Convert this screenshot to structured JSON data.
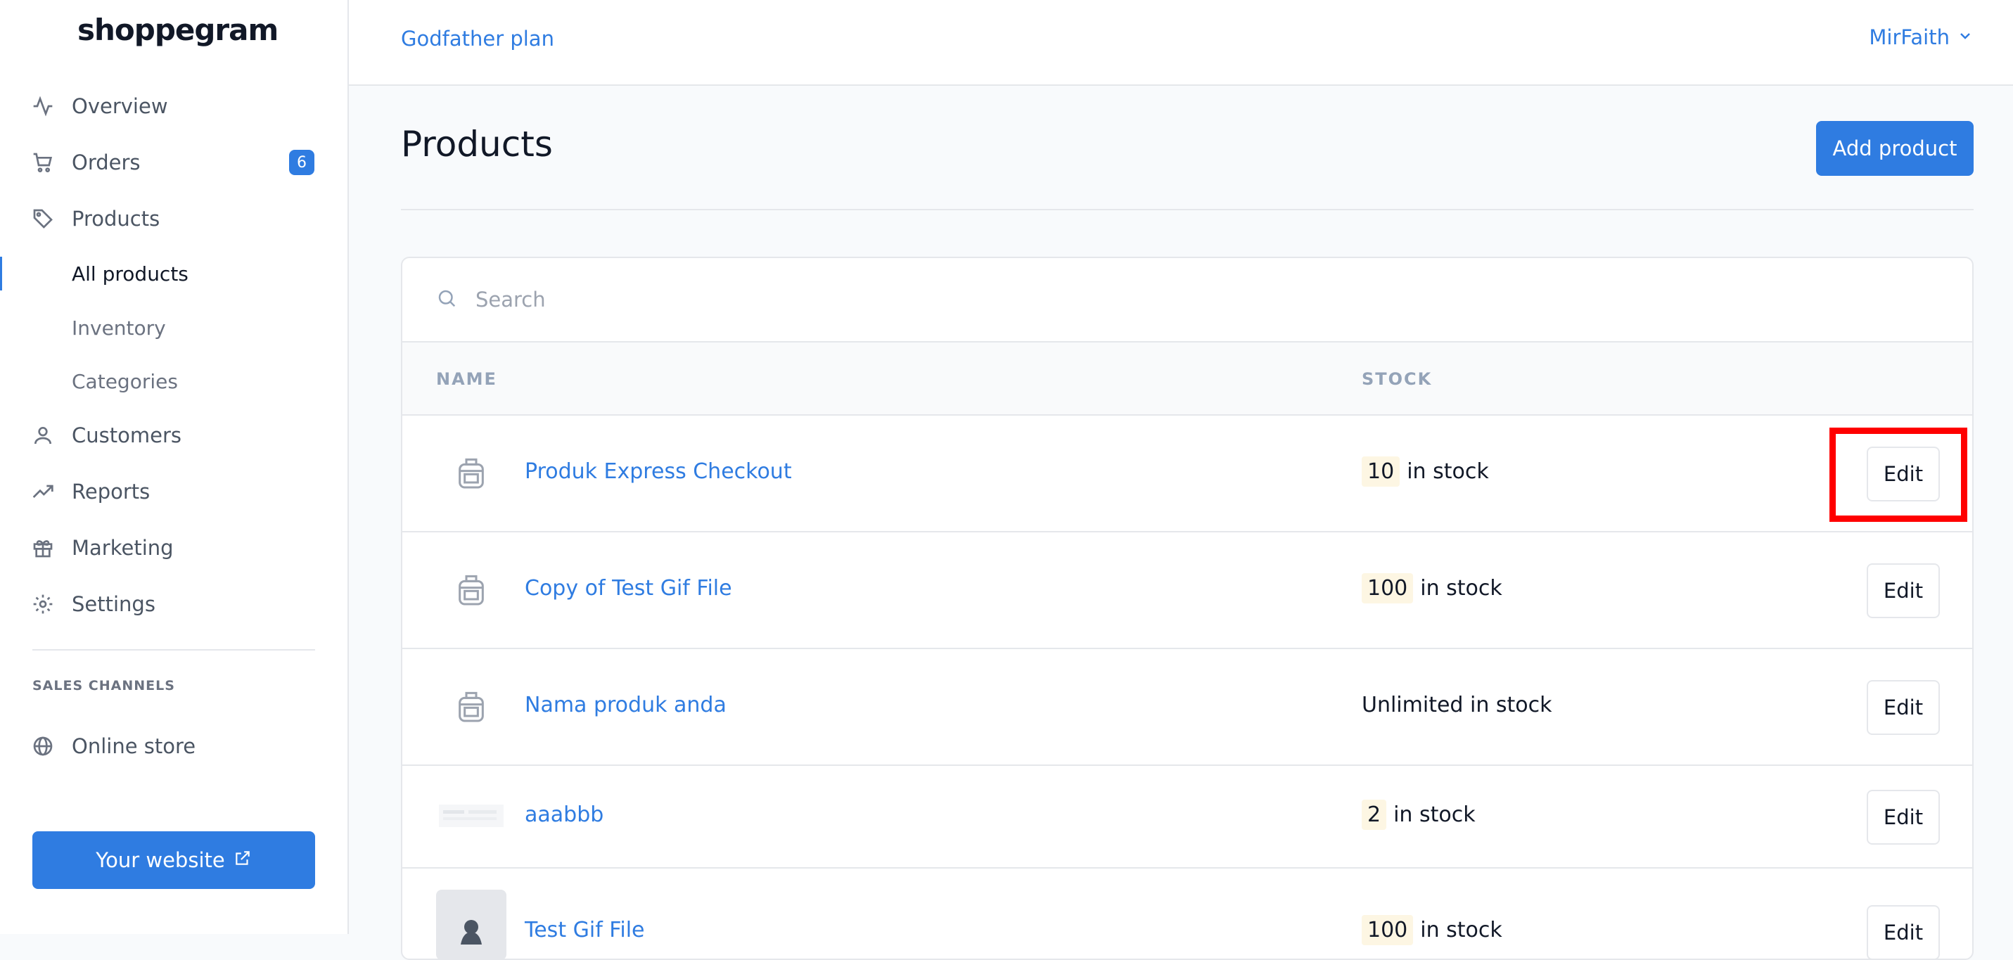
{
  "sidebar": {
    "logo": "shoppegram",
    "items": [
      {
        "label": "Overview",
        "icon": "activity-icon"
      },
      {
        "label": "Orders",
        "icon": "cart-icon",
        "badge": "6"
      },
      {
        "label": "Products",
        "icon": "tag-icon"
      },
      {
        "label": "All products"
      },
      {
        "label": "Inventory"
      },
      {
        "label": "Categories"
      },
      {
        "label": "Customers",
        "icon": "user-icon"
      },
      {
        "label": "Reports",
        "icon": "trending-up-icon"
      },
      {
        "label": "Marketing",
        "icon": "gift-icon"
      },
      {
        "label": "Settings",
        "icon": "gear-icon"
      }
    ],
    "sales_channels_label": "SALES CHANNELS",
    "online_store_label": "Online store",
    "website_button_label": "Your website"
  },
  "header": {
    "plan": "Godfather plan",
    "user": "MirFaith"
  },
  "main": {
    "title": "Products",
    "add_button": "Add product",
    "search_placeholder": "Search",
    "columns": [
      "NAME",
      "STOCK"
    ],
    "rows": [
      {
        "name": "Produk Express Checkout",
        "stock_num": "10",
        "stock_text": "in stock",
        "edit": "Edit"
      },
      {
        "name": "Copy of Test Gif File",
        "stock_num": "100",
        "stock_text": "in stock",
        "edit": "Edit"
      },
      {
        "name": "Nama produk anda",
        "stock_num": "",
        "stock_text": "Unlimited in stock",
        "edit": "Edit"
      },
      {
        "name": "aaabbb",
        "stock_num": "2",
        "stock_text": "in stock",
        "edit": "Edit"
      },
      {
        "name": "Test Gif File",
        "stock_num": "100",
        "stock_text": "in stock",
        "edit": "Edit"
      }
    ]
  },
  "colors": {
    "accent": "#2f7ce1",
    "highlight": "#ff0000"
  }
}
